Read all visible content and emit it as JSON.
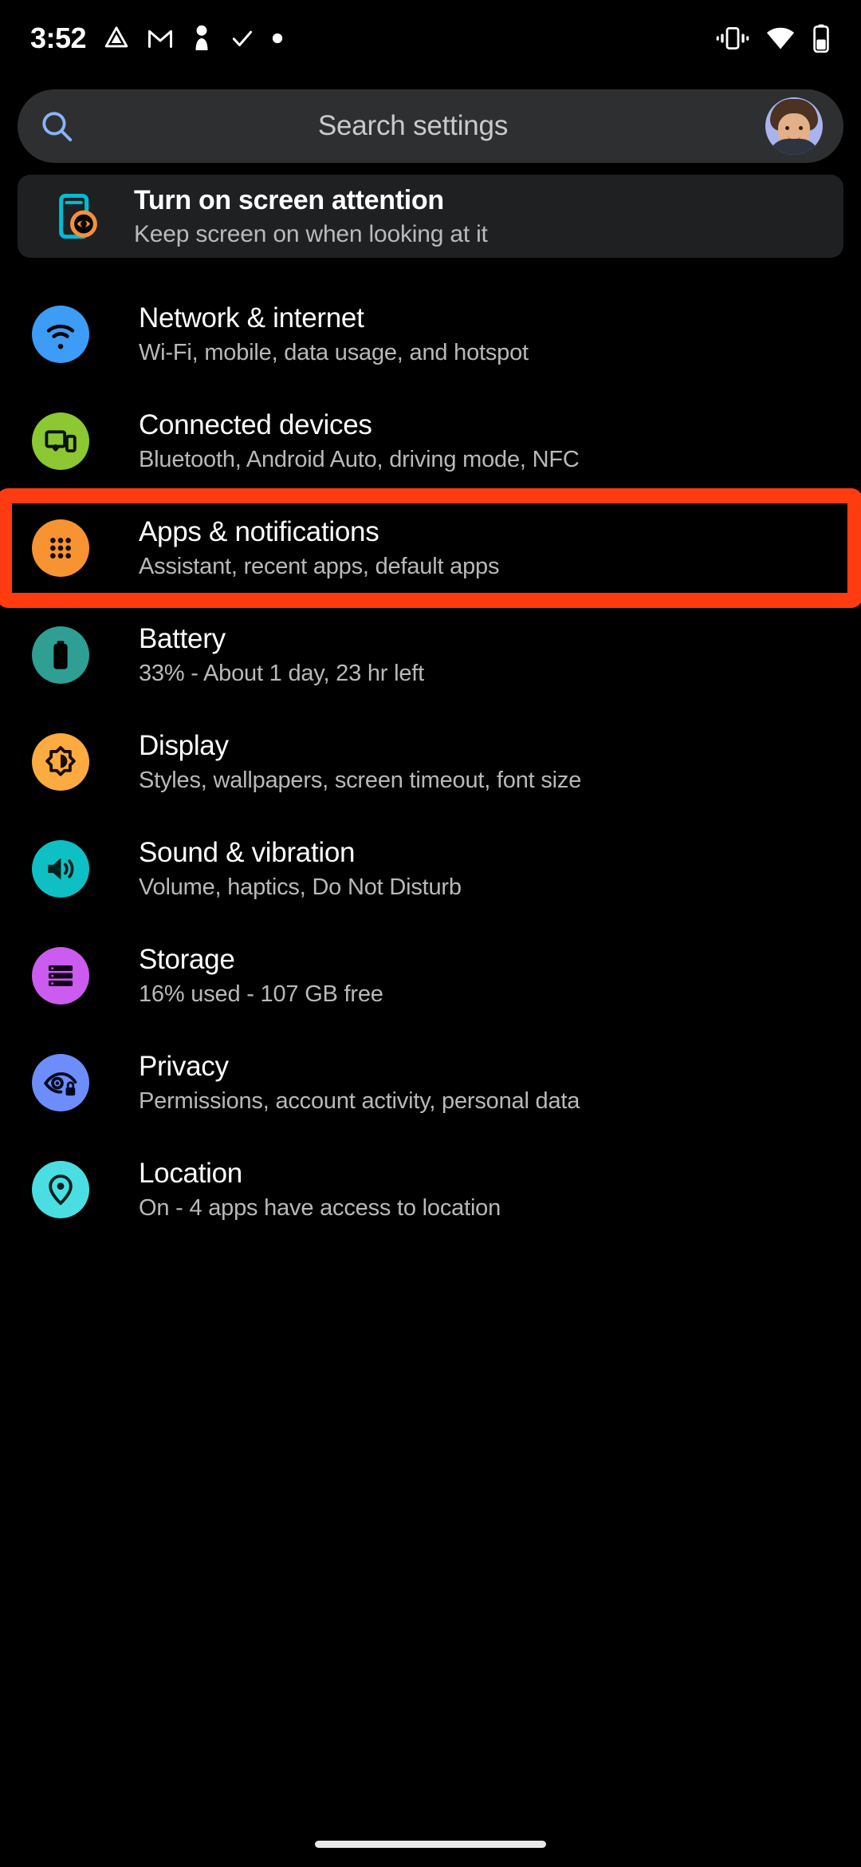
{
  "status_bar": {
    "time": "3:52",
    "left_icons": [
      "drive-icon",
      "gmail-icon",
      "pawn-icon",
      "check-icon",
      "dot-icon"
    ],
    "right_icons": [
      "vibrate-icon",
      "wifi-icon",
      "battery-icon"
    ]
  },
  "search": {
    "placeholder": "Search settings",
    "icon": "search-icon",
    "icon_color": "#8ab4f8",
    "avatar": "user-avatar"
  },
  "suggestion": {
    "title": "Turn on screen attention",
    "subtitle": "Keep screen on when looking at it",
    "icon": "screen-attention-icon",
    "icon_colors": {
      "phone": "#00bcd4",
      "eye": "#f5903c"
    }
  },
  "highlight": {
    "color": "#ff3b0f",
    "target": "Apps & notifications"
  },
  "settings": [
    {
      "title": "Network & internet",
      "subtitle": "Wi-Fi, mobile, data usage, and hotspot",
      "icon": "wifi-icon",
      "color": "#3d9cf5",
      "glyph_color": "#000000"
    },
    {
      "title": "Connected devices",
      "subtitle": "Bluetooth, Android Auto, driving mode, NFC",
      "icon": "devices-icon",
      "color": "#8bc832",
      "glyph_color": "#0a1400"
    },
    {
      "title": "Apps & notifications",
      "subtitle": "Assistant, recent apps, default apps",
      "icon": "apps-grid-icon",
      "color": "#f79331",
      "glyph_color": "#1a0c00",
      "highlighted": true
    },
    {
      "title": "Battery",
      "subtitle": "33% - About 1 day, 23 hr left",
      "icon": "battery-icon",
      "color": "#2f9e93",
      "glyph_color": "#000000"
    },
    {
      "title": "Display",
      "subtitle": "Styles, wallpapers, screen timeout, font size",
      "icon": "brightness-icon",
      "color": "#fbab40",
      "glyph_color": "#1a0c00"
    },
    {
      "title": "Sound & vibration",
      "subtitle": "Volume, haptics, Do Not Disturb",
      "icon": "speaker-icon",
      "color": "#0ec0c4",
      "glyph_color": "#00201f"
    },
    {
      "title": "Storage",
      "subtitle": "16% used - 107 GB free",
      "icon": "storage-icon",
      "color": "#cc5bef",
      "glyph_color": "#14001c"
    },
    {
      "title": "Privacy",
      "subtitle": "Permissions, account activity, personal data",
      "icon": "privacy-eye-lock-icon",
      "color": "#6d8dfa",
      "glyph_color": "#000820"
    },
    {
      "title": "Location",
      "subtitle": "On - 4 apps have access to location",
      "icon": "location-pin-icon",
      "color": "#4adee2",
      "glyph_color": "#00201f"
    }
  ],
  "home_indicator": "home-gesture-bar"
}
